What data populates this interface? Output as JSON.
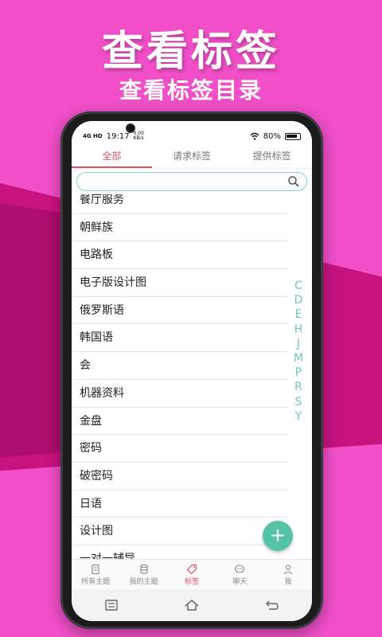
{
  "promo": {
    "headline": "查看标签",
    "subline": "查看标签目录"
  },
  "status": {
    "time": "19:17",
    "net_speed": "0.00 KB/s",
    "signal": "4G HD",
    "battery": "80%"
  },
  "tabs": [
    {
      "label": "全部",
      "active": true
    },
    {
      "label": "请求标签",
      "active": false
    },
    {
      "label": "提供标签",
      "active": false
    }
  ],
  "search": {
    "placeholder": "",
    "icon": "search-icon"
  },
  "list": {
    "items": [
      "餐厅服务",
      "朝鲜族",
      "电路板",
      "电子版设计图",
      "俄罗斯语",
      "韩国语",
      "会",
      "机器资料",
      "金盘",
      "密码",
      "破密码",
      "日语",
      "设计图",
      "一对一辅导"
    ]
  },
  "index_letters": [
    "C",
    "D",
    "E",
    "H",
    "J",
    "M",
    "P",
    "R",
    "S",
    "Y"
  ],
  "fab": {
    "label": "+"
  },
  "bottom_nav": [
    {
      "label": "所有主题",
      "icon": "document-icon",
      "active": false
    },
    {
      "label": "我的主题",
      "icon": "database-icon",
      "active": false
    },
    {
      "label": "标签",
      "icon": "tag-icon",
      "active": true
    },
    {
      "label": "聊天",
      "icon": "chat-icon",
      "active": false
    },
    {
      "label": "我",
      "icon": "person-icon",
      "active": false
    }
  ],
  "colors": {
    "accent": "#d4546a",
    "teal": "#55c3a6",
    "background": "#f04fc8"
  }
}
